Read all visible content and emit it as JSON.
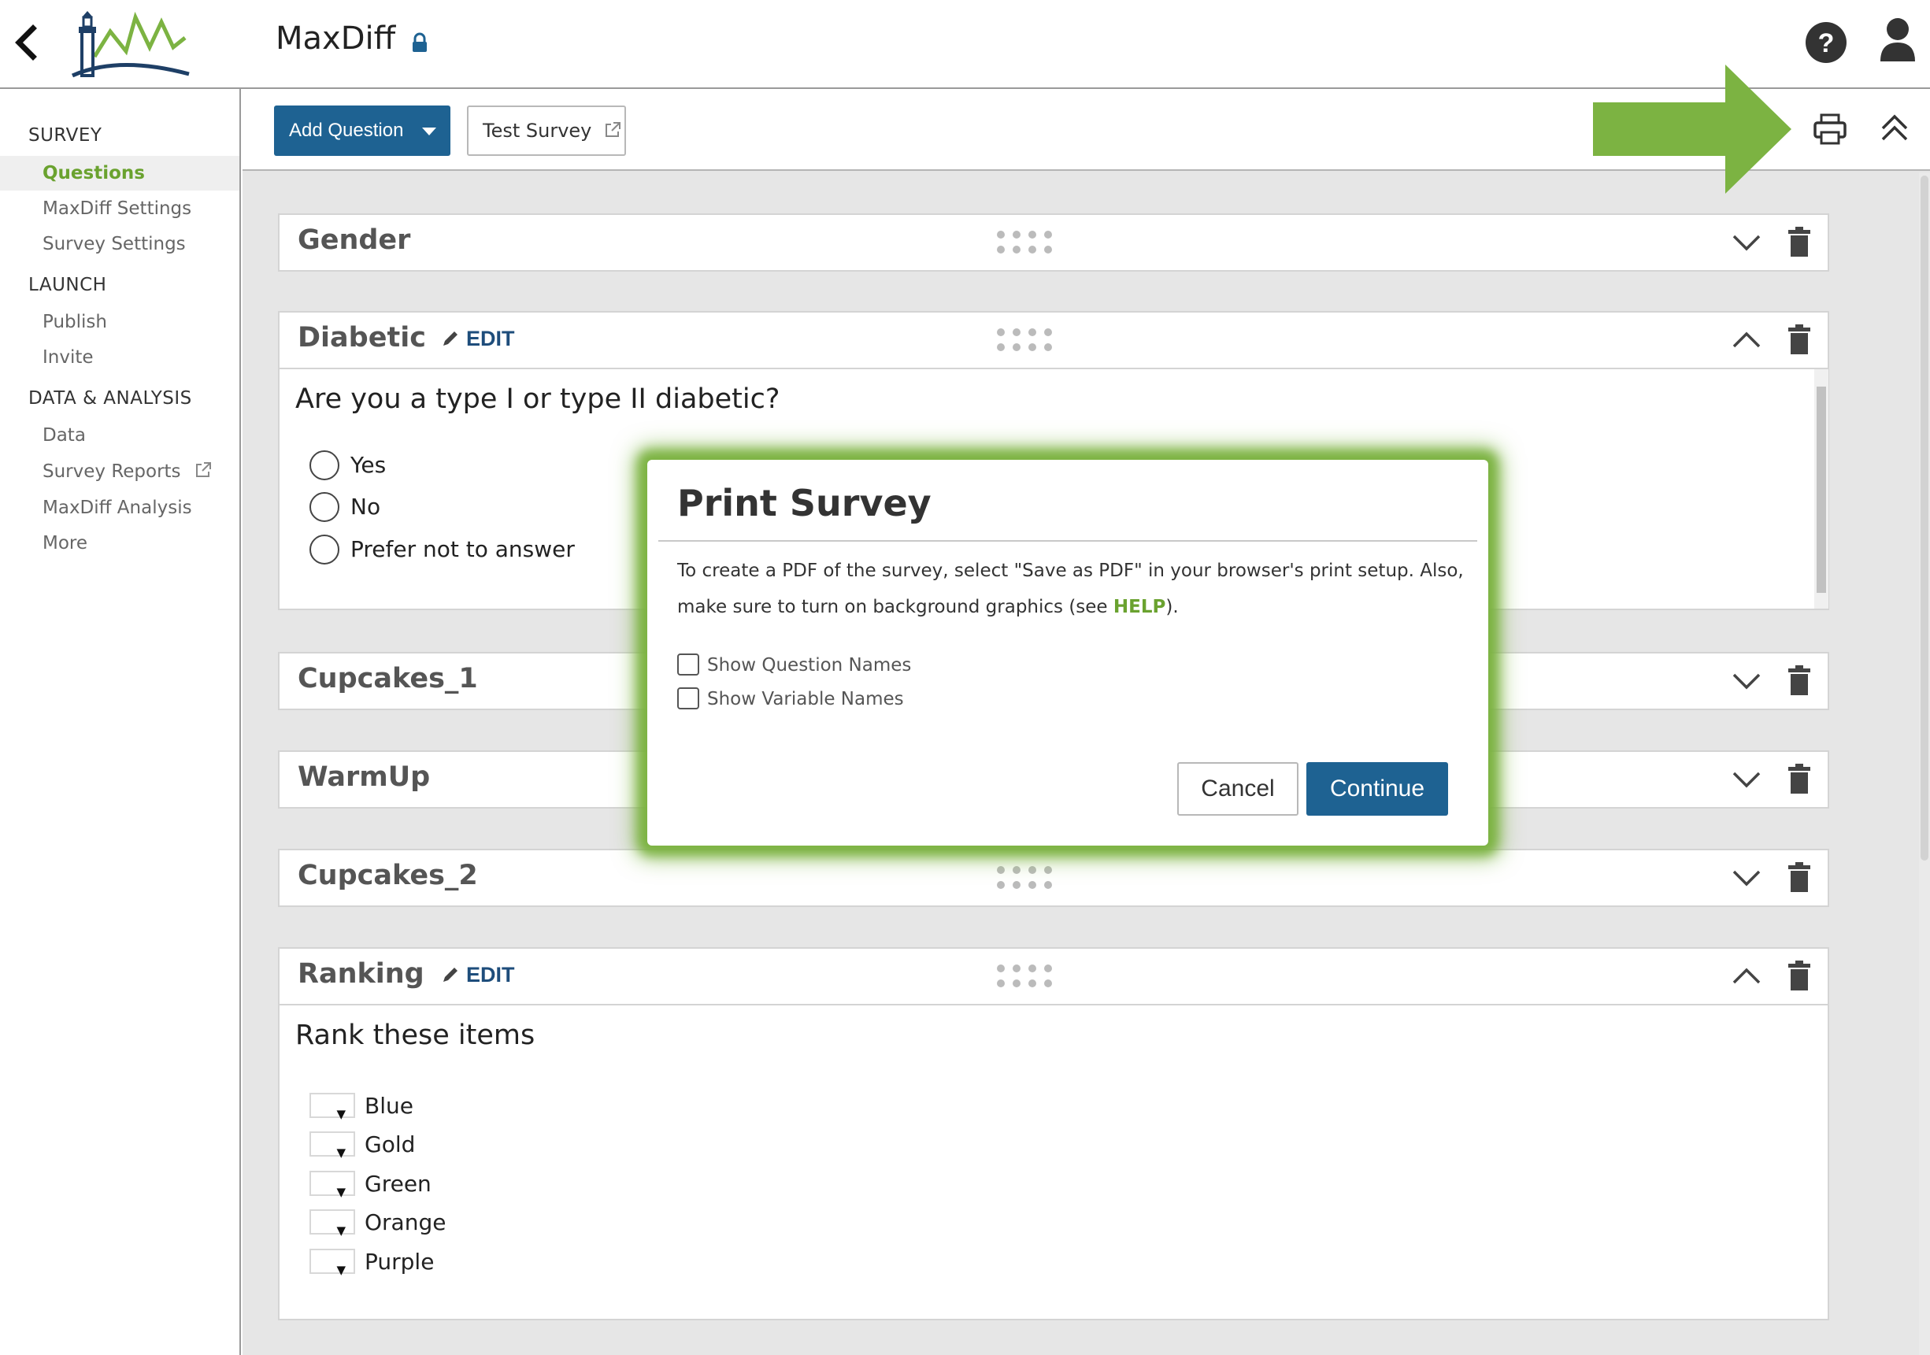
{
  "header": {
    "app_title": "MaxDiff",
    "icons": {
      "back": "back-arrow-icon",
      "logo": "lighthouse-logo",
      "lock": "lock-icon",
      "help": "help-icon",
      "user": "user-icon"
    }
  },
  "sidebar": {
    "sections": [
      {
        "title": "SURVEY",
        "items": [
          {
            "label": "Questions",
            "active": true
          },
          {
            "label": "MaxDiff Settings"
          },
          {
            "label": "Survey Settings"
          }
        ]
      },
      {
        "title": "LAUNCH",
        "items": [
          {
            "label": "Publish"
          },
          {
            "label": "Invite"
          }
        ]
      },
      {
        "title": "DATA & ANALYSIS",
        "items": [
          {
            "label": "Data"
          },
          {
            "label": "Survey Reports",
            "icon": "external-link-icon"
          },
          {
            "label": "MaxDiff Analysis"
          },
          {
            "label": "More"
          }
        ]
      }
    ]
  },
  "toolbar": {
    "add_question": "Add Question",
    "test_survey": "Test Survey"
  },
  "questions": [
    {
      "name": "Gender",
      "expanded": false
    },
    {
      "name": "Diabetic",
      "expanded": true,
      "edit_label": "EDIT",
      "text": "Are you a type I or type II diabetic?",
      "options": [
        "Yes",
        "No",
        "Prefer not to answer"
      ]
    },
    {
      "name": "Cupcakes_1",
      "expanded": false
    },
    {
      "name": "WarmUp",
      "expanded": false
    },
    {
      "name": "Cupcakes_2",
      "expanded": false
    },
    {
      "name": "Ranking",
      "expanded": true,
      "edit_label": "EDIT",
      "text": "Rank these items",
      "options": [
        "Blue",
        "Gold",
        "Green",
        "Orange",
        "Purple"
      ]
    }
  ],
  "modal": {
    "title": "Print Survey",
    "text_before_link": "To create a PDF of the survey, select \"Save as PDF\" in your browser's print setup. Also, make sure to turn on background graphics (see ",
    "link": "HELP",
    "text_after_link": ").",
    "checkboxes": [
      "Show Question Names",
      "Show Variable Names"
    ],
    "cancel": "Cancel",
    "continue": "Continue"
  },
  "colors": {
    "primary": "#1e6292",
    "accent_green": "#6aa22f",
    "highlight_arrow": "#7cb342"
  }
}
